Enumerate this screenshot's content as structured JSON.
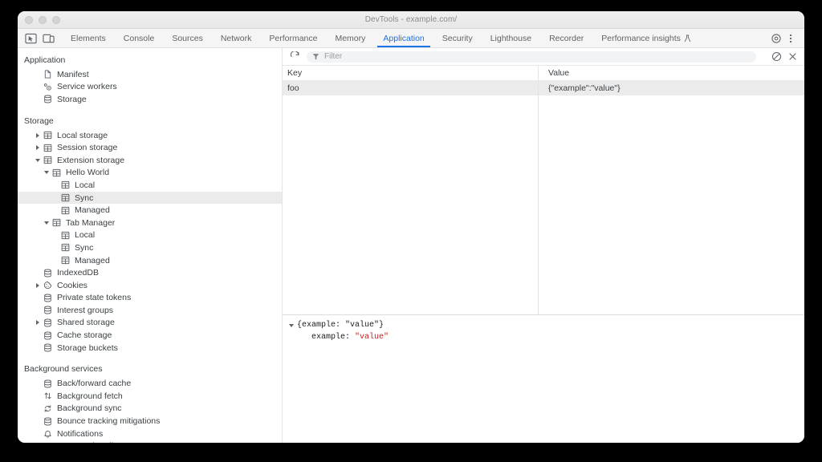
{
  "window": {
    "title": "DevTools - example.com/",
    "traffic_lights": [
      "close",
      "minimize",
      "maximize"
    ]
  },
  "tabstrip": {
    "left_icons": [
      {
        "name": "inspect-element-icon",
        "label": "Inspect element"
      },
      {
        "name": "device-toolbar-icon",
        "label": "Toggle device toolbar"
      }
    ],
    "tabs": [
      {
        "label": "Elements",
        "active": false
      },
      {
        "label": "Console",
        "active": false
      },
      {
        "label": "Sources",
        "active": false
      },
      {
        "label": "Network",
        "active": false
      },
      {
        "label": "Performance",
        "active": false
      },
      {
        "label": "Memory",
        "active": false
      },
      {
        "label": "Application",
        "active": true
      },
      {
        "label": "Security",
        "active": false
      },
      {
        "label": "Lighthouse",
        "active": false
      },
      {
        "label": "Recorder",
        "active": false
      },
      {
        "label": "Performance insights",
        "active": false,
        "badge": "beta-flask-icon"
      }
    ],
    "right_icons": [
      {
        "name": "settings-gear-icon",
        "label": "Settings"
      },
      {
        "name": "more-options-icon",
        "label": "Customize and control DevTools"
      }
    ],
    "accent_color": "#1a73e8"
  },
  "sidebar": {
    "sections": [
      {
        "title": "Application",
        "items": [
          {
            "label": "Manifest",
            "icon": "manifest-document-icon",
            "indent": 1,
            "twisty": "none",
            "selected": false
          },
          {
            "label": "Service workers",
            "icon": "service-workers-gear-icon",
            "indent": 1,
            "twisty": "none",
            "selected": false
          },
          {
            "label": "Storage",
            "icon": "storage-database-icon",
            "indent": 1,
            "twisty": "none",
            "selected": false
          }
        ]
      },
      {
        "title": "Storage",
        "items": [
          {
            "label": "Local storage",
            "icon": "table-grid-icon",
            "indent": 1,
            "twisty": "collapsed",
            "selected": false
          },
          {
            "label": "Session storage",
            "icon": "table-grid-icon",
            "indent": 1,
            "twisty": "collapsed",
            "selected": false
          },
          {
            "label": "Extension storage",
            "icon": "table-grid-icon",
            "indent": 1,
            "twisty": "expanded",
            "selected": false
          },
          {
            "label": "Hello World",
            "icon": "table-grid-icon",
            "indent": 2,
            "twisty": "expanded",
            "selected": false
          },
          {
            "label": "Local",
            "icon": "table-grid-icon",
            "indent": 3,
            "twisty": "none",
            "selected": false
          },
          {
            "label": "Sync",
            "icon": "table-grid-icon",
            "indent": 3,
            "twisty": "none",
            "selected": true
          },
          {
            "label": "Managed",
            "icon": "table-grid-icon",
            "indent": 3,
            "twisty": "none",
            "selected": false
          },
          {
            "label": "Tab Manager",
            "icon": "table-grid-icon",
            "indent": 2,
            "twisty": "expanded",
            "selected": false
          },
          {
            "label": "Local",
            "icon": "table-grid-icon",
            "indent": 3,
            "twisty": "none",
            "selected": false
          },
          {
            "label": "Sync",
            "icon": "table-grid-icon",
            "indent": 3,
            "twisty": "none",
            "selected": false
          },
          {
            "label": "Managed",
            "icon": "table-grid-icon",
            "indent": 3,
            "twisty": "none",
            "selected": false
          },
          {
            "label": "IndexedDB",
            "icon": "storage-database-icon",
            "indent": 1,
            "twisty": "none",
            "selected": false
          },
          {
            "label": "Cookies",
            "icon": "cookie-icon",
            "indent": 1,
            "twisty": "collapsed",
            "selected": false
          },
          {
            "label": "Private state tokens",
            "icon": "storage-database-icon",
            "indent": 1,
            "twisty": "none",
            "selected": false
          },
          {
            "label": "Interest groups",
            "icon": "storage-database-icon",
            "indent": 1,
            "twisty": "none",
            "selected": false
          },
          {
            "label": "Shared storage",
            "icon": "storage-database-icon",
            "indent": 1,
            "twisty": "collapsed",
            "selected": false
          },
          {
            "label": "Cache storage",
            "icon": "storage-database-icon",
            "indent": 1,
            "twisty": "none",
            "selected": false
          },
          {
            "label": "Storage buckets",
            "icon": "storage-database-icon",
            "indent": 1,
            "twisty": "none",
            "selected": false
          }
        ]
      },
      {
        "title": "Background services",
        "items": [
          {
            "label": "Back/forward cache",
            "icon": "storage-database-icon",
            "indent": 1,
            "twisty": "none",
            "selected": false
          },
          {
            "label": "Background fetch",
            "icon": "background-fetch-arrows-icon",
            "indent": 1,
            "twisty": "none",
            "selected": false
          },
          {
            "label": "Background sync",
            "icon": "background-sync-icon",
            "indent": 1,
            "twisty": "none",
            "selected": false
          },
          {
            "label": "Bounce tracking mitigations",
            "icon": "storage-database-icon",
            "indent": 1,
            "twisty": "none",
            "selected": false
          },
          {
            "label": "Notifications",
            "icon": "notifications-bell-icon",
            "indent": 1,
            "twisty": "none",
            "selected": false
          },
          {
            "label": "Payment handler",
            "icon": "payment-handler-card-icon",
            "indent": 1,
            "twisty": "none",
            "selected": false
          }
        ]
      }
    ],
    "selection_color": "#ebebeb"
  },
  "main": {
    "toolbar": {
      "refresh_icon": "refresh-icon",
      "filter_icon": "filter-funnel-icon",
      "filter_placeholder": "Filter",
      "filter_value": "",
      "clear_icon": "clear-all-icon",
      "close_icon": "close-icon"
    },
    "table": {
      "columns": [
        "Key",
        "Value"
      ],
      "rows": [
        {
          "key": "foo",
          "value": "{\"example\":\"value\"}",
          "selected": true
        }
      ]
    },
    "preview": {
      "root": "{example: \"value\"}",
      "entry_key": "example:",
      "entry_value": "\"value\"",
      "expanded": true,
      "string_color": "#c5221f"
    }
  }
}
